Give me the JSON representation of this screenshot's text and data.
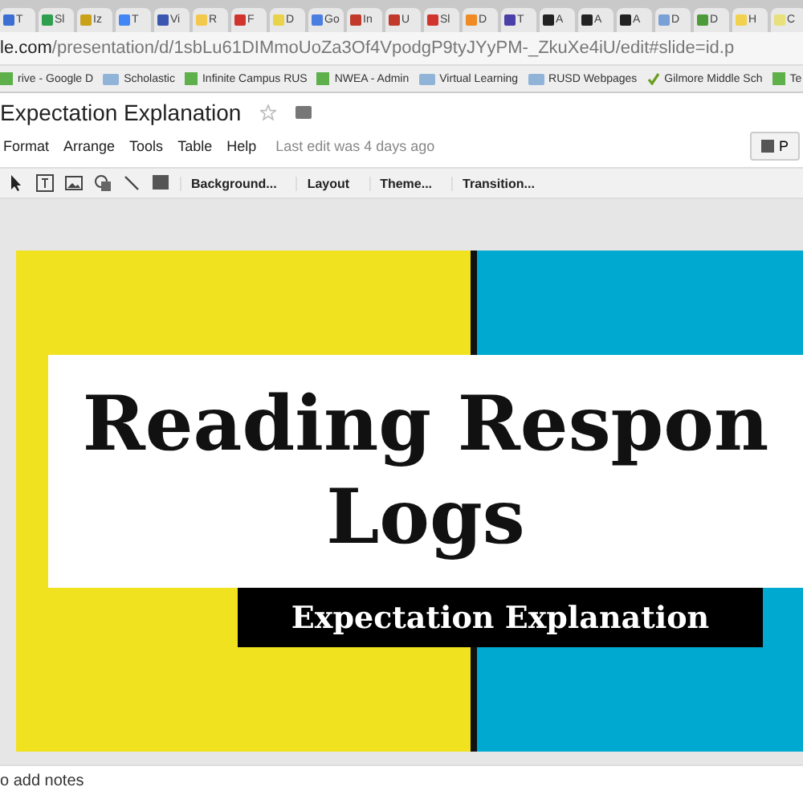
{
  "tabs": [
    {
      "label": "T",
      "color": "#3c6fd1"
    },
    {
      "label": "Sl",
      "color": "#2e9e4f"
    },
    {
      "label": "Iz",
      "color": "#c9a21a"
    },
    {
      "label": "T",
      "color": "#4285f4"
    },
    {
      "label": "Vi",
      "color": "#3a56b0"
    },
    {
      "label": "R",
      "color": "#f2c94c"
    },
    {
      "label": "F",
      "color": "#d0342c"
    },
    {
      "label": "D",
      "color": "#e8d34a"
    },
    {
      "label": "Go",
      "color": "#4a7ee0"
    },
    {
      "label": "In",
      "color": "#c0392b"
    },
    {
      "label": "U",
      "color": "#c0392b"
    },
    {
      "label": "Sl",
      "color": "#d0342c"
    },
    {
      "label": "D",
      "color": "#f08a24"
    },
    {
      "label": "T",
      "color": "#4b3fa8"
    },
    {
      "label": "A",
      "color": "#222222"
    },
    {
      "label": "A",
      "color": "#222222"
    },
    {
      "label": "A",
      "color": "#222222"
    },
    {
      "label": "D",
      "color": "#7aa0d8"
    },
    {
      "label": "D",
      "color": "#4c9a3a"
    },
    {
      "label": "H",
      "color": "#f2d24c"
    },
    {
      "label": "C",
      "color": "#e8e07a"
    }
  ],
  "address": {
    "host": "le.com",
    "path": "/presentation/d/1sbLu61DIMmoUoZa3Of4VpodgP9tyJYyPM-_ZkuXe4iU/edit#slide=id.p"
  },
  "bookmarks": [
    {
      "label": "rive - Google D",
      "kind": "page"
    },
    {
      "label": "Scholastic",
      "kind": "folder"
    },
    {
      "label": "Infinite Campus RUS",
      "kind": "page"
    },
    {
      "label": "NWEA - Admin",
      "kind": "page"
    },
    {
      "label": "Virtual Learning",
      "kind": "folder"
    },
    {
      "label": "RUSD Webpages",
      "kind": "folder"
    },
    {
      "label": "Gilmore Middle Sch",
      "kind": "check"
    },
    {
      "label": "Te",
      "kind": "page"
    }
  ],
  "doc_title": "Expectation Explanation",
  "menu": [
    "Format",
    "Arrange",
    "Tools",
    "Table",
    "Help"
  ],
  "last_edit": "Last edit was 4 days ago",
  "present_button": "P",
  "toolbar_buttons": [
    "Background...",
    "Layout",
    "Theme...",
    "Transition..."
  ],
  "slide": {
    "title_lines": [
      "Reading Respon",
      "Logs"
    ],
    "subtitle": "Expectation Explanation"
  },
  "notes_placeholder": "o add notes"
}
